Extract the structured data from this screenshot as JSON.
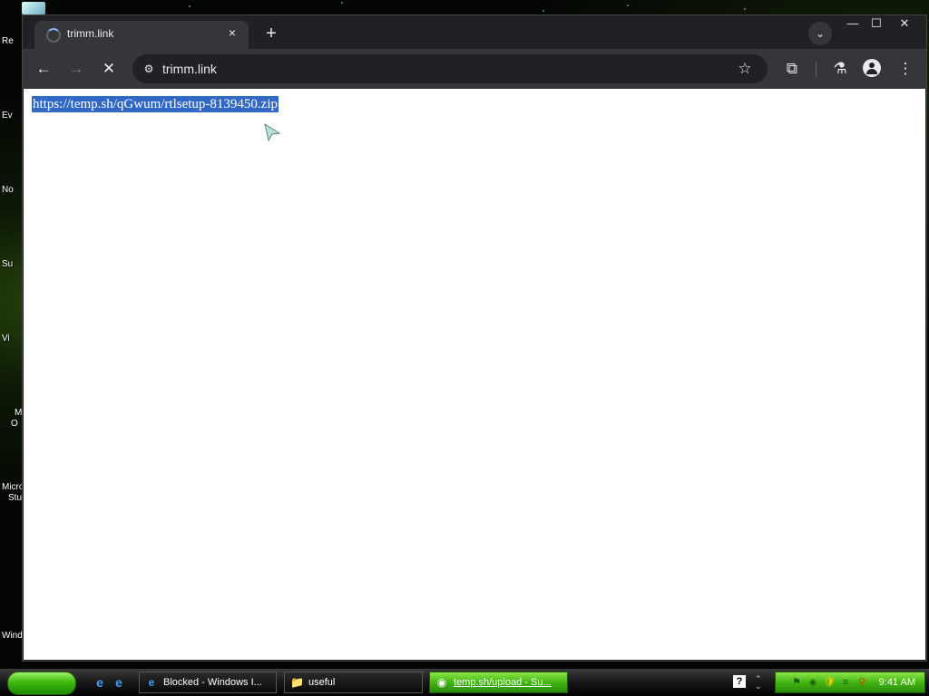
{
  "desktop": {
    "icon_labels": [
      "Re",
      "Ev",
      "No",
      "Su",
      "Vi",
      "M",
      "O",
      "Micro",
      "Stu",
      "Wind"
    ]
  },
  "browser": {
    "tab": {
      "title": "trimm.link",
      "close_symbol": "×"
    },
    "new_tab_symbol": "+",
    "tab_search_symbol": "⌄",
    "window_controls": {
      "minimize": "—",
      "maximize": "☐",
      "close": "✕"
    },
    "toolbar": {
      "back_symbol": "←",
      "forward_symbol": "→",
      "stop_symbol": "✕",
      "site_info_symbol": "⚙",
      "url": "trimm.link",
      "bookmark_symbol": "☆",
      "extensions_symbol": "⧉",
      "labs_symbol": "⚗",
      "menu_symbol": "⋮"
    },
    "content": {
      "selected_text": "https://temp.sh/qGwum/rtlsetup-8139450.zip"
    }
  },
  "taskbar": {
    "quick_launch": [
      "e",
      "e"
    ],
    "tasks": [
      {
        "label": "Blocked - Windows I...",
        "icon": "e",
        "active": false
      },
      {
        "label": "useful",
        "icon": "📁",
        "active": false
      },
      {
        "label": "temp.sh/upload - Su...",
        "icon": "◉",
        "active": true
      }
    ],
    "help_symbol": "?",
    "tray_icons": [
      "⚑",
      "◈",
      "🛡",
      "≡",
      "⚲"
    ],
    "clock": "9:41 AM"
  },
  "colors": {
    "selection": "#3168c6",
    "chrome_dark": "#202124",
    "chrome_toolbar": "#35363a",
    "taskbar_green": "#42b512"
  }
}
